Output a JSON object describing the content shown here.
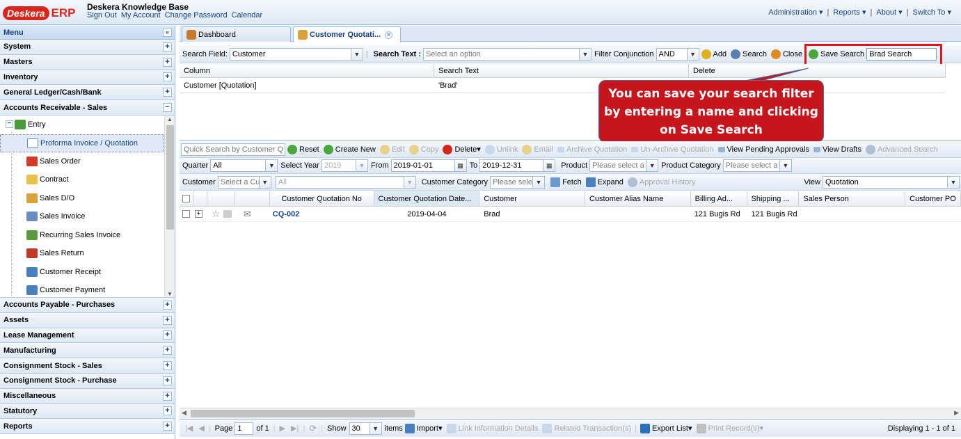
{
  "header": {
    "logo_text": "Deskera",
    "logo_erp": "ERP",
    "title": "Deskera Knowledge Base",
    "links": [
      "Sign Out",
      "My Account",
      "Change Password",
      "Calendar"
    ],
    "right_links": [
      "Administration",
      "Reports",
      "About",
      "Switch To"
    ]
  },
  "sidebar": {
    "menu_label": "Menu",
    "top_sections": [
      "System",
      "Masters",
      "Inventory",
      "General Ledger/Cash/Bank",
      "Accounts Receivable - Sales"
    ],
    "tree_root": "Entry",
    "tree_items": [
      "Proforma Invoice / Quotation",
      "Sales Order",
      "Contract",
      "Sales D/O",
      "Sales Invoice",
      "Recurring Sales Invoice",
      "Sales Return",
      "Customer Receipt",
      "Customer Payment"
    ],
    "bottom_sections": [
      "Accounts Payable - Purchases",
      "Assets",
      "Lease Management",
      "Manufacturing",
      "Consignment Stock - Sales",
      "Consignment Stock - Purchase",
      "Miscellaneous",
      "Statutory",
      "Reports"
    ]
  },
  "tabs": [
    "Dashboard",
    "Customer Quotati..."
  ],
  "search_bar": {
    "field_label": "Search Field:",
    "field_value": "Customer",
    "text_label": "Search Text :",
    "text_placeholder": "Select an option",
    "conj_label": "Filter Conjunction",
    "conj_value": "AND",
    "add": "Add",
    "search": "Search",
    "close": "Close",
    "save_search": "Save Search",
    "save_name": "Brad Search"
  },
  "filter_table": {
    "headers": [
      "Column",
      "Search Text",
      "Delete"
    ],
    "rows": [
      [
        "Customer [Quotation]",
        "'Brad'",
        ""
      ]
    ]
  },
  "callout": [
    "You can save your search filter",
    "by entering a name and clicking",
    "on Save Search"
  ],
  "toolbar": {
    "quick_search": "Quick Search by Customer Q",
    "reset": "Reset",
    "create_new": "Create New",
    "edit": "Edit",
    "copy": "Copy",
    "delete": "Delete",
    "unlink": "Unlink",
    "email": "Email",
    "archive": "Archive Quotation",
    "unarchive": "Un-Archive Quotation",
    "pending": "View Pending Approvals",
    "drafts": "View Drafts",
    "advanced": "Advanced Search"
  },
  "filters1": {
    "quarter_label": "Quarter",
    "quarter_value": "All",
    "year_label": "Select Year",
    "year_value": "2019",
    "from_label": "From",
    "from_value": "2019-01-01",
    "to_label": "To",
    "to_value": "2019-12-31",
    "product_label": "Product",
    "product_placeholder": "Please select a",
    "category_label": "Product Category",
    "category_placeholder": "Please select a"
  },
  "filters2": {
    "customer_label": "Customer",
    "customer_placeholder": "Select a Cu",
    "all_value": "All",
    "cust_cat_label": "Customer Category",
    "cust_cat_placeholder": "Please sele",
    "fetch": "Fetch",
    "expand": "Expand",
    "approval": "Approval History",
    "view_label": "View",
    "view_value": "Quotation"
  },
  "grid": {
    "headers": [
      "Customer Quotation No",
      "Customer Quotation Date...",
      "Customer",
      "Customer Alias Name",
      "Billing Ad...",
      "Shipping ...",
      "Sales Person",
      "Customer PO"
    ],
    "rows": [
      {
        "no": "CQ-002",
        "date": "2019-04-04",
        "customer": "Brad",
        "alias": "",
        "billing": "121 Bugis Rd",
        "shipping": "121 Bugis Rd",
        "sales": "",
        "po": ""
      }
    ]
  },
  "pager": {
    "page_label": "Page",
    "page_value": "1",
    "of_label": "of 1",
    "show_label": "Show",
    "show_value": "30",
    "items_label": "items",
    "import": "Import",
    "link_info": "Link Information Details",
    "related": "Related Transaction(s)",
    "export": "Export List",
    "print": "Print Record(s)",
    "displaying": "Displaying 1 - 1 of 1"
  }
}
